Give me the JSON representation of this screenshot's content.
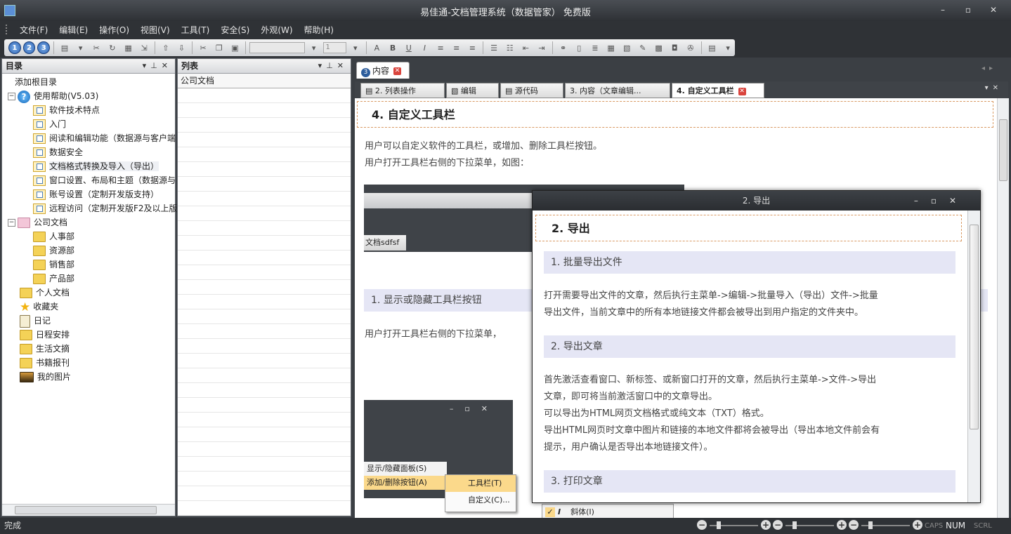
{
  "window": {
    "title": "易佳通-文档管理系统（数据管家） 免费版",
    "minimize": "–",
    "maximize": "▫",
    "close": "✕"
  },
  "menu": [
    "文件(F)",
    "编辑(E)",
    "操作(O)",
    "视图(V)",
    "工具(T)",
    "安全(S)",
    "外观(W)",
    "帮助(H)"
  ],
  "toolbar": {
    "font_size": "1",
    "numbers": [
      "1",
      "2",
      "3"
    ]
  },
  "tree_panel": {
    "title": "目录",
    "items": [
      {
        "label": "添加根目录",
        "level": 0,
        "icon": "none"
      },
      {
        "label": "使用帮助(V5.03)",
        "level": 0,
        "icon": "help-icon",
        "expand": "−"
      },
      {
        "label": "软件技术特点",
        "level": 1,
        "icon": "note-folder-icon"
      },
      {
        "label": "入门",
        "level": 1,
        "icon": "note-folder-icon"
      },
      {
        "label": "阅读和编辑功能（数据源与客户端",
        "level": 1,
        "icon": "note-folder-icon"
      },
      {
        "label": "数据安全",
        "level": 1,
        "icon": "note-folder-icon"
      },
      {
        "label": "文档格式转换及导入（导出）",
        "level": 1,
        "icon": "note-folder-icon"
      },
      {
        "label": "窗口设置、布局和主题（数据源与",
        "level": 1,
        "icon": "note-folder-icon"
      },
      {
        "label": "账号设置（定制开发版支持）",
        "level": 1,
        "icon": "note-folder-icon"
      },
      {
        "label": "远程访问（定制开发版F2及以上版",
        "level": 1,
        "icon": "note-folder-icon"
      },
      {
        "label": "公司文档",
        "level": 0,
        "icon": "books-icon",
        "expand": "−"
      },
      {
        "label": "人事部",
        "level": 1,
        "icon": "folder-icon"
      },
      {
        "label": "资源部",
        "level": 1,
        "icon": "folder-icon"
      },
      {
        "label": "销售部",
        "level": 1,
        "icon": "folder-icon"
      },
      {
        "label": "产品部",
        "level": 1,
        "icon": "folder-icon"
      },
      {
        "label": "个人文档",
        "level": 0,
        "icon": "folder-icon"
      },
      {
        "label": "收藏夹",
        "level": 0,
        "icon": "star-icon"
      },
      {
        "label": "日记",
        "level": 0,
        "icon": "clipboard-icon"
      },
      {
        "label": "日程安排",
        "level": 0,
        "icon": "folder-icon"
      },
      {
        "label": "生活文摘",
        "level": 0,
        "icon": "folder-icon"
      },
      {
        "label": "书籍报刊",
        "level": 0,
        "icon": "folder-icon"
      },
      {
        "label": "我的图片",
        "level": 0,
        "icon": "picture-icon"
      }
    ]
  },
  "list_panel": {
    "title": "列表",
    "header": "公司文档"
  },
  "content": {
    "main_tab": "内容",
    "main_tab_num": "3",
    "subtabs": [
      "2. 列表操作",
      "编辑",
      "源代码",
      "3. 内容（文章编辑...",
      "4. 自定义工具栏"
    ],
    "heading": "4.  自定义工具栏",
    "p1": "用户可以自定义软件的工具栏，或增加、删除工具栏按钮。",
    "p2": "用户打开工具栏右侧的下拉菜单，如图：",
    "shot_tab": "文档sdfsf",
    "sec1": "1.  显示或隐藏工具栏按钮",
    "p3": "用户打开工具栏右侧的下拉菜单，",
    "menu_show": "显示/隐藏面板(S)",
    "menu_add": "添加/删除按钮(A)",
    "menu_toolbar": "工具栏(T)",
    "menu_custom": "自定义(C)...",
    "menu_italic": "斜体(I)"
  },
  "popup": {
    "title": "2. 导出",
    "heading": "2.  导出",
    "s1": "1.  批量导出文件",
    "s1_text1": "打开需要导出文件的文章，然后执行主菜单->编辑->批量导入（导出）文件->批量",
    "s1_text2": "导出文件，当前文章中的所有本地链接文件都会被导出到用户指定的文件夹中。",
    "s2": "2.  导出文章",
    "s2_text1": "首先激活查看窗口、新标签、或新窗口打开的文章，然后执行主菜单->文件->导出",
    "s2_text2": "文章，即可将当前激活窗口中的文章导出。",
    "s2_text3": "可以导出为HTML网页文档格式或纯文本（TXT）格式。",
    "s2_text4": "导出HTML网页时文章中图片和链接的本地文件都将会被导出（导出本地文件前会有",
    "s2_text5": "提示，用户确认是否导出本地链接文件）。",
    "s3": "3.  打印文章"
  },
  "status": {
    "text": "完成",
    "num": "NUM",
    "caps": "CAPS",
    "scrl": "SCRL"
  }
}
